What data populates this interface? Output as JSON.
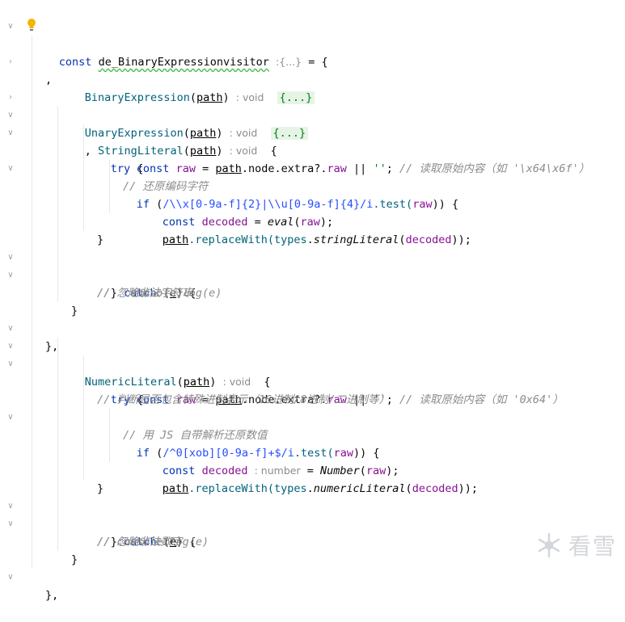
{
  "lines": {
    "l1": {
      "kw": "const",
      "name": "de_BinaryExpressionvisitor",
      "hint": ":{...}",
      "rest": " = {"
    },
    "l3": {
      "name": "BinaryExpression",
      "param": "path",
      "hint": ": void",
      "fold": "{...}"
    },
    "l4": {
      "text": ","
    },
    "l5": {
      "name": "UnaryExpression",
      "param": "path",
      "hint": ": void",
      "fold": "{...}"
    },
    "l6": {
      "prefix": ", ",
      "name": "StringLiteral",
      "param": "path",
      "hint": ": void",
      "rest": "{"
    },
    "l7": {
      "kw": "try",
      "rest": " {"
    },
    "l8": {
      "kw": "const",
      "var": "raw",
      "eq": " = ",
      "param": "path",
      "chain1": ".node.extra?.",
      "chain2": "raw",
      "op": " || ",
      "str": "''",
      "semi": "; ",
      "comment": "// 读取原始内容（如 '\\x64\\x6f'）"
    },
    "l9": {
      "kw": "if",
      "open": " (",
      "regex": "/\\\\x[0-9a-f]{2}|\\\\u[0-9a-f]{4}/i",
      "test": ".test(",
      "arg": "raw",
      "close": ")) {"
    },
    "l10": {
      "comment": "// 还原编码字符"
    },
    "l11": {
      "kw": "const",
      "var": "decoded",
      "eq": " = ",
      "fn": "eval",
      "arg": "raw",
      "close": ");"
    },
    "l12": {
      "param": "path",
      "meth": ".replaceWith(",
      "obj": "types",
      "dot": ".",
      "fn": "stringLiteral",
      "arg": "decoded",
      "close": "));"
    },
    "l13": {
      "text": "}"
    },
    "l14": {
      "open": "} ",
      "kw": "catch",
      "paren": " (",
      "param": "e",
      "close": ") {"
    },
    "l15": {
      "comment": "// 忽略非法字符串"
    },
    "l16": {
      "comment": "//   console.log(e)"
    },
    "l17": {
      "text": "}"
    },
    "l18": {
      "text": "},"
    },
    "l19": {
      "name": "NumericLiteral",
      "param": "path",
      "hint": ": void",
      "rest": "{"
    },
    "l20": {
      "kw": "try",
      "rest": " {"
    },
    "l21": {
      "kw": "const",
      "var": "raw",
      "eq": " = ",
      "param": "path",
      "chain1": ".node.extra?.",
      "chain2": "raw",
      "op": " || ",
      "str": "''",
      "semi": "; ",
      "comment": "// 读取原始内容（如 '0x64'）"
    },
    "l22": {
      "comment": "// 判断是否包含特殊进制表示（16进制/8进制/二进制等）"
    },
    "l23": {
      "kw": "if",
      "open": " (",
      "regex": "/^0[xob][0-9a-f]+$/i",
      "test": ".test(",
      "arg": "raw",
      "close": ")) {"
    },
    "l24": {
      "comment": "// 用 JS 自带解析还原数值"
    },
    "l25": {
      "kw": "const",
      "var": "decoded",
      "hint": ": number",
      "eq": " = ",
      "fn": "Number",
      "arg": "raw",
      "close": ");"
    },
    "l26": {
      "param": "path",
      "meth": ".replaceWith(",
      "obj": "types",
      "dot": ".",
      "fn": "numericLiteral",
      "arg": "decoded",
      "close": "));"
    },
    "l27": {
      "text": "}"
    },
    "l28": {
      "open": "} ",
      "kw": "catch",
      "paren": " (",
      "param": "e",
      "close": ") {"
    },
    "l29": {
      "comment": "// 忽略非法数字"
    },
    "l30": {
      "comment": "// console.log(e)"
    },
    "l31": {
      "text": "}"
    },
    "l32": {
      "text": "},"
    }
  },
  "gutter": {
    "expanded": "∨",
    "collapsed": "›"
  },
  "watermark": "看雪",
  "colors": {
    "keyword": "#0033b3",
    "function": "#00627a",
    "variable": "#871094",
    "string": "#067d17",
    "comment": "#8c8c8c"
  }
}
